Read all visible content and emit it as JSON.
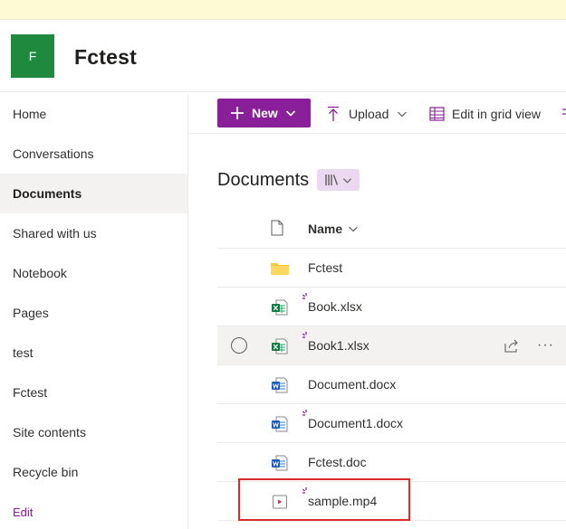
{
  "site": {
    "logo_letter": "F",
    "title": "Fctest",
    "logo_color": "#1f8a3d"
  },
  "nav": {
    "items": [
      {
        "label": "Home"
      },
      {
        "label": "Conversations"
      },
      {
        "label": "Documents",
        "active": true
      },
      {
        "label": "Shared with us"
      },
      {
        "label": "Notebook"
      },
      {
        "label": "Pages"
      },
      {
        "label": "test"
      },
      {
        "label": "Fctest"
      },
      {
        "label": "Site contents"
      },
      {
        "label": "Recycle bin"
      }
    ],
    "edit_label": "Edit"
  },
  "commandbar": {
    "new_label": "New",
    "upload_label": "Upload",
    "grid_label": "Edit in grid view",
    "accent_color": "#8a1f9a"
  },
  "library": {
    "title": "Documents",
    "name_column": "Name",
    "files": [
      {
        "name": "Fctest",
        "type": "folder",
        "new": false
      },
      {
        "name": "Book.xlsx",
        "type": "excel",
        "new": true
      },
      {
        "name": "Book1.xlsx",
        "type": "excel",
        "new": true,
        "hover": true
      },
      {
        "name": "Document.docx",
        "type": "word",
        "new": false
      },
      {
        "name": "Document1.docx",
        "type": "word",
        "new": true
      },
      {
        "name": "Fctest.doc",
        "type": "word",
        "new": false
      },
      {
        "name": "sample.mp4",
        "type": "video",
        "new": true
      }
    ]
  }
}
